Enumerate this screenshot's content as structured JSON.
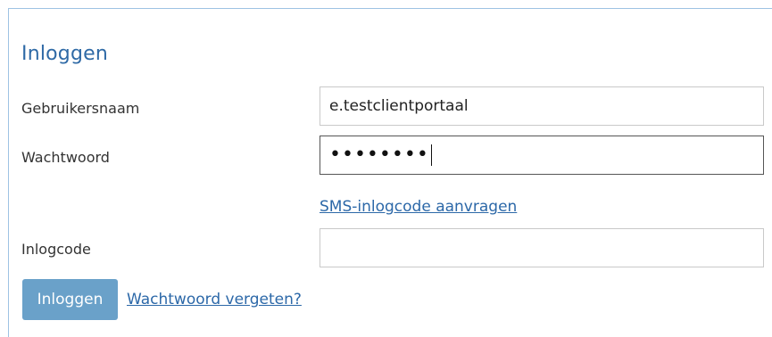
{
  "form": {
    "title": "Inloggen",
    "username": {
      "label": "Gebruikersnaam",
      "value": "e.testclientportaal"
    },
    "password": {
      "label": "Wachtwoord",
      "masked_value": "••••••••"
    },
    "sms_link": "SMS-inlogcode aanvragen",
    "code": {
      "label": "Inlogcode",
      "value": ""
    },
    "submit_label": "Inloggen",
    "forgot_link": "Wachtwoord vergeten?"
  },
  "colors": {
    "accent": "#2f6aa6",
    "link": "#2c68a8",
    "button": "#6aa1c9",
    "panel_border": "#9ec3e3"
  }
}
